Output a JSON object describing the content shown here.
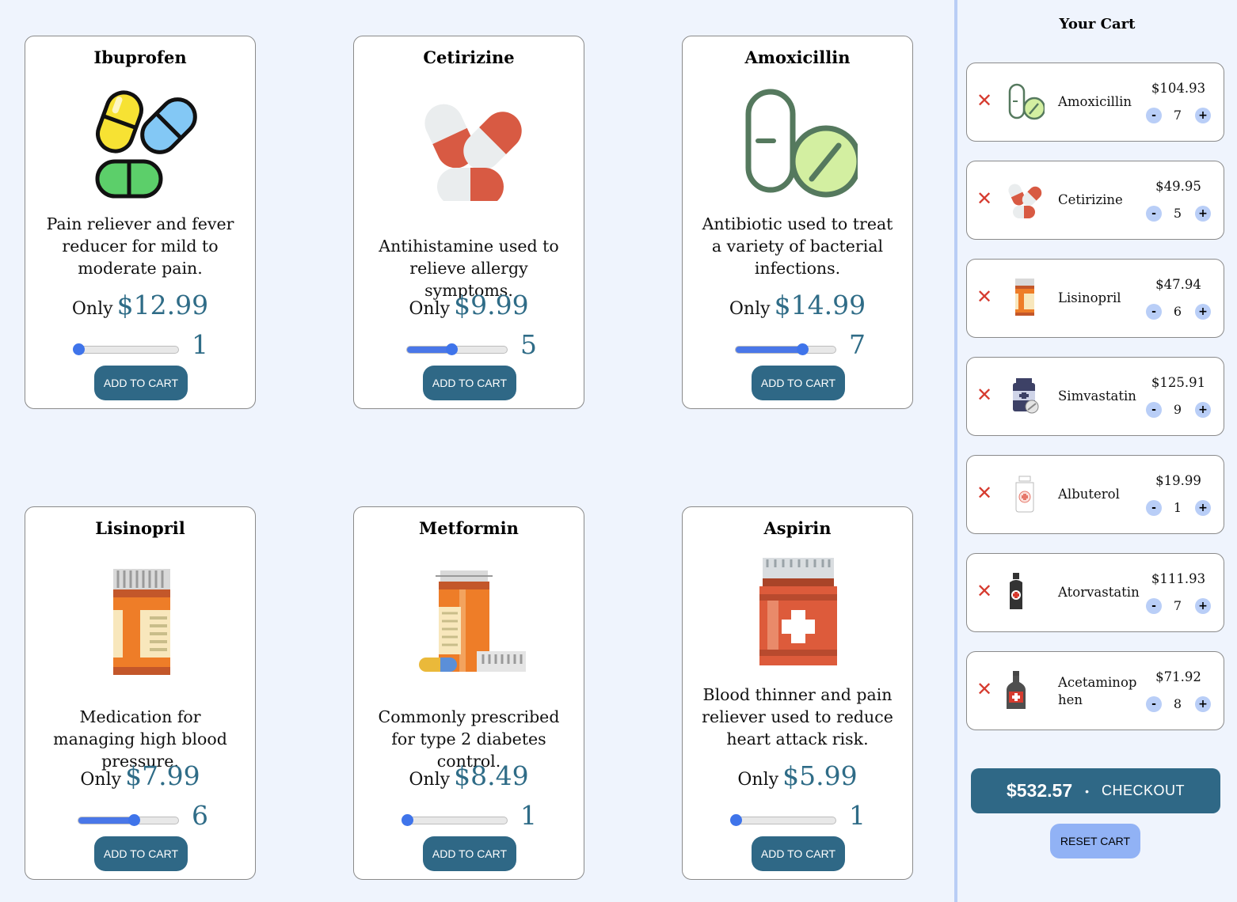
{
  "products": [
    {
      "name": "Ibuprofen",
      "desc": "Pain reliever and fever reducer for mild to moderate pain.",
      "price_label": "Only",
      "price": "$12.99",
      "qty": "1",
      "qty_value": 1,
      "add": "ADD TO CART",
      "icon": "pills-icon"
    },
    {
      "name": "Cetirizine",
      "desc": "Antihistamine used to relieve allergy symptoms.",
      "price_label": "Only",
      "price": "$9.99",
      "qty": "5",
      "qty_value": 5,
      "add": "ADD TO CART",
      "icon": "capsules-icon"
    },
    {
      "name": "Amoxicillin",
      "desc": "Antibiotic used to treat a variety of bacterial infections.",
      "price_label": "Only",
      "price": "$14.99",
      "qty": "7",
      "qty_value": 7,
      "add": "ADD TO CART",
      "icon": "capsule-tablet-icon"
    },
    {
      "name": "Lisinopril",
      "desc": "Medication for managing high blood pressure.",
      "price_label": "Only",
      "price": "$7.99",
      "qty": "6",
      "qty_value": 6,
      "add": "ADD TO CART",
      "icon": "pill-bottle-icon"
    },
    {
      "name": "Metformin",
      "desc": "Commonly prescribed for type 2 diabetes control.",
      "price_label": "Only",
      "price": "$8.49",
      "qty": "1",
      "qty_value": 1,
      "add": "ADD TO CART",
      "icon": "bottle-capsule-icon"
    },
    {
      "name": "Aspirin",
      "desc": "Blood thinner and pain reliever used to reduce heart attack risk.",
      "price_label": "Only",
      "price": "$5.99",
      "qty": "1",
      "qty_value": 1,
      "add": "ADD TO CART",
      "icon": "medicine-jar-icon"
    }
  ],
  "slider": {
    "min": 1,
    "max": 10
  },
  "cart": {
    "title": "Your Cart",
    "remove_glyph": "✕",
    "minus_glyph": "-",
    "plus_glyph": "+",
    "items": [
      {
        "name": "Amoxicillin",
        "price": "$104.93",
        "qty": "7",
        "icon": "capsule-tablet-icon"
      },
      {
        "name": "Cetirizine",
        "price": "$49.95",
        "qty": "5",
        "icon": "capsules-icon"
      },
      {
        "name": "Lisinopril",
        "price": "$47.94",
        "qty": "6",
        "icon": "pill-bottle-icon"
      },
      {
        "name": "Simvastatin",
        "price": "$125.91",
        "qty": "9",
        "icon": "jar-tablet-icon"
      },
      {
        "name": "Albuterol",
        "price": "$19.99",
        "qty": "1",
        "icon": "white-bottle-icon"
      },
      {
        "name": "Atorvastatin",
        "price": "$111.93",
        "qty": "7",
        "icon": "dark-bottle-icon"
      },
      {
        "name": "Acetaminophen",
        "name_line1": "Acetaminop",
        "name_line2": "hen",
        "price": "$71.92",
        "qty": "8",
        "icon": "syrup-bottle-icon"
      }
    ],
    "total": "$532.57",
    "separator": "•",
    "checkout": "CHECKOUT",
    "reset": "RESET CART"
  },
  "colors": {
    "accent": "#2f6886",
    "price": "#2f6c87",
    "slider": "#4a77e8",
    "remove": "#d63b2f",
    "background": "#eff4fd"
  }
}
